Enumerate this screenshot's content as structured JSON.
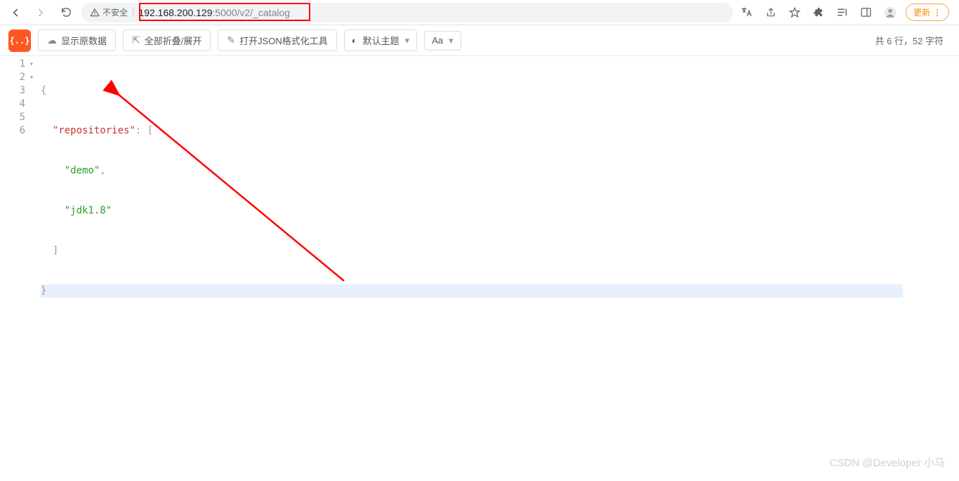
{
  "browser": {
    "security_label": "不安全",
    "url_host": "192.168.200.129",
    "url_port": ":5000",
    "url_path": "/v2/_catalog",
    "update_label": "更新"
  },
  "toolbar": {
    "logo_text": "{..}",
    "raw_data": "显示原数据",
    "collapse": "全部折叠/展开",
    "open_tool": "打开JSON格式化工具",
    "theme": "默认主题",
    "font_btn": "Aa"
  },
  "stats": {
    "text": "共 6 行，52 字符"
  },
  "code": {
    "line1": "{",
    "line2_key": "\"repositories\"",
    "line2_after": ": [",
    "line3_str": "\"demo\"",
    "line3_comma": ",",
    "line4_str": "\"jdk1.8\"",
    "line5": "]",
    "line6": "}"
  },
  "gutter": [
    "1",
    "2",
    "3",
    "4",
    "5",
    "6"
  ],
  "watermark": "CSDN @Developer 小马"
}
